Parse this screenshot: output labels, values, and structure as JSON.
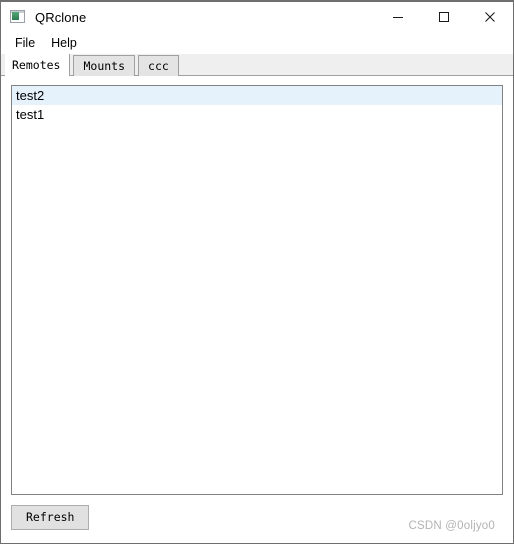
{
  "window": {
    "title": "QRclone",
    "icon": "app-window-icon",
    "controls": {
      "minimize": "minimize-icon",
      "maximize": "maximize-icon",
      "close": "close-icon"
    }
  },
  "menubar": {
    "items": [
      {
        "label": "File"
      },
      {
        "label": "Help"
      }
    ]
  },
  "tabs": [
    {
      "label": "Remotes",
      "active": true
    },
    {
      "label": "Mounts",
      "active": false
    },
    {
      "label": "ccc",
      "active": false
    }
  ],
  "remotes_list": {
    "items": [
      {
        "label": "test2",
        "selected": true
      },
      {
        "label": "test1",
        "selected": false
      }
    ]
  },
  "buttons": {
    "refresh": "Refresh"
  },
  "watermark": {
    "text": "CSDN @0oljyo0"
  },
  "colors": {
    "selection": "#e5f1fb",
    "tab_inactive": "#e4e4e4",
    "tab_strip": "#efefef",
    "border": "#828282",
    "button_face": "#e1e1e1",
    "watermark": "#b3b3b3"
  }
}
